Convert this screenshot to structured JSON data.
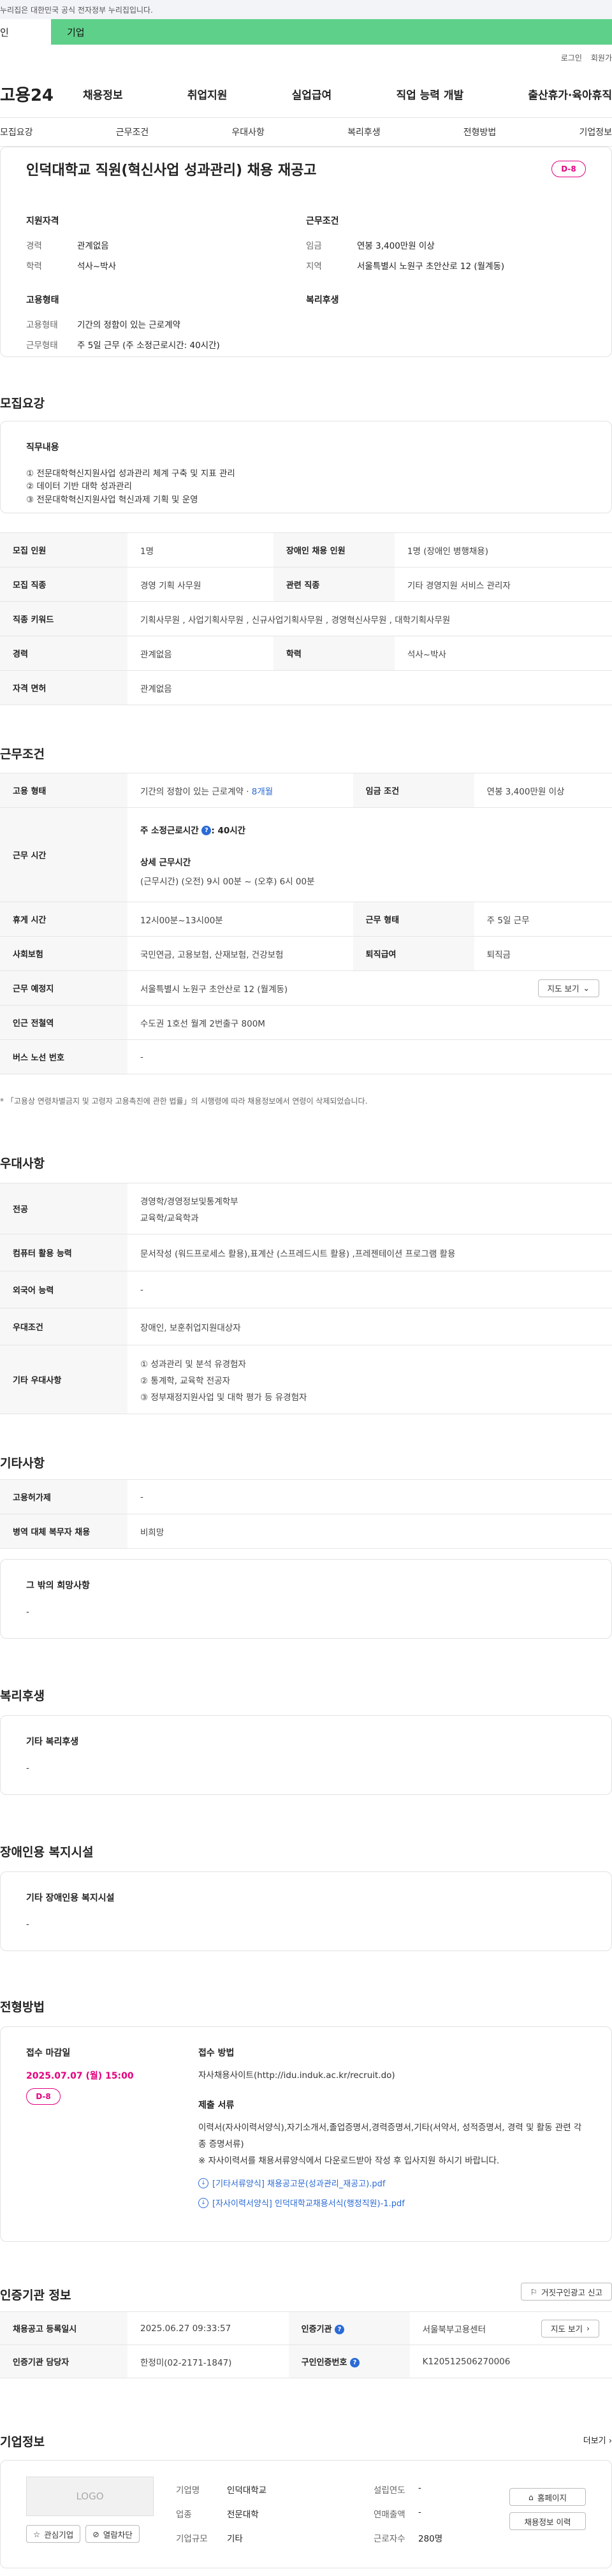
{
  "banner": {
    "text": "누리집은 대한민국 공식 전자정부 누리집입니다."
  },
  "tabs": {
    "t1": "인",
    "t2": "기업"
  },
  "util": {
    "login": "로그인",
    "signup": "회원가"
  },
  "gnb": {
    "logo": "고용24",
    "menu": [
      "채용정보",
      "취업지원",
      "실업급여",
      "직업 능력 개발",
      "출산휴가·육아휴직"
    ]
  },
  "anchors": [
    "모집요강",
    "근무조건",
    "우대사항",
    "복리후생",
    "전형방법",
    "기업정보"
  ],
  "title": {
    "heading": "인덕대학교 직원(혁신사업 성과관리) 채용 재공고",
    "dday": "D-8",
    "qual_title": "지원자격",
    "qual_rows": [
      {
        "k": "경력",
        "v": "관계없음"
      },
      {
        "k": "학력",
        "v": "석사~박사"
      }
    ],
    "cond_title": "근무조건",
    "cond_rows": [
      {
        "k": "임금",
        "v": "연봉 3,400만원 이상"
      },
      {
        "k": "지역",
        "v": "서울특별시 노원구 초안산로 12 (월계동)"
      }
    ],
    "emp_title": "고용형태",
    "emp_rows": [
      {
        "k": "고용형태",
        "v": "기간의 정함이 있는 근로계약"
      },
      {
        "k": "근무형태",
        "v": "주 5일 근무 (주 소정근로시간: 40시간)"
      }
    ],
    "welfare_title": "복리후생"
  },
  "recruit": {
    "section": "모집요강",
    "duty_title": "직무내용",
    "duty_lines": [
      "① 전문대학혁신지원사업 성과관리 체계 구축 및 지표 관리",
      "② 데이터 기반 대학 성과관리",
      "③ 전문대학혁신지원사업 혁신과제 기획 및 운영"
    ],
    "rows": [
      {
        "h1": "모집 인원",
        "v1": "1명",
        "h2": "장애인 채용 인원",
        "v2": "1명 (장애인 병행채용)"
      },
      {
        "h1": "모집 직종",
        "v1": "경영 기획 사무원",
        "h2": "관련 직종",
        "v2": "기타 경영지원 서비스 관리자"
      },
      {
        "h1": "직종 키워드",
        "v1": "기획사무원 , 사업기획사무원 , 신규사업기획사무원 , 경영혁신사무원 , 대학기획사무원"
      },
      {
        "h1": "경력",
        "v1": "관계없음",
        "h2": "학력",
        "v2": "석사~박사"
      },
      {
        "h1": "자격 면허",
        "v1": "관계없음"
      }
    ]
  },
  "work": {
    "section": "근무조건",
    "emp_h": "고용 형태",
    "emp_v": "기간의 정함이 있는 근로계약 · ",
    "emp_link": "8개월",
    "wage_h": "임금 조건",
    "wage_v": "연봉 3,400만원 이상",
    "hours_h": "근무 시간",
    "hours_sub": "주 소정근로시간",
    "hours_q": "?",
    "hours_sub_v": ": 40시간",
    "hours_detail_t": "상세 근무시간",
    "hours_detail_v": "(근무시간) (오전) 9시 00분 ~ (오후) 6시 00분",
    "rest_h": "휴게 시간",
    "rest_v": "12시00분~13시00분",
    "form_h": "근무 형태",
    "form_v": "주 5일 근무",
    "ins_h": "사회보험",
    "ins_v": "국민연금, 고용보험, 산재보험, 건강보험",
    "ret_h": "퇴직급여",
    "ret_v": "퇴직금",
    "loc_h": "근무 예정지",
    "loc_v": "서울특별시 노원구 초안산로 12 (월계동)",
    "map_btn": "지도 보기",
    "subway_h": "인근 전철역",
    "subway_v": "수도권 1호선 월계 2번출구 800M",
    "bus_h": "버스 노선 번호",
    "bus_v": "-",
    "note": "* 「고용상 연령차별금지 및 고령자 고용촉진에 관한 법률」의 시행령에 따라 채용정보에서 연령이 삭제되었습니다."
  },
  "pref": {
    "section": "우대사항",
    "rows": [
      {
        "h": "전공",
        "v": [
          "경영학/경영정보및통계학부",
          "교육학/교육학과"
        ]
      },
      {
        "h": "컴퓨터 활용 능력",
        "v": [
          "문서작성 (워드프로세스 활용),표계산 (스프레드시트 활용) ,프레젠테이션 프로그램 활용"
        ]
      },
      {
        "h": "외국어 능력",
        "v": [
          "-"
        ]
      },
      {
        "h": "우대조건",
        "v": [
          "장애인, 보훈취업지원대상자"
        ]
      },
      {
        "h": "기타 우대사항",
        "v": [
          "① 성과관리 및 분석 유경험자",
          "② 통계학, 교육학 전공자",
          "③ 정부재정지원사업 및 대학 평가 등 유경험자"
        ]
      }
    ]
  },
  "etc": {
    "section": "기타사항",
    "rows": [
      {
        "h": "고용허가제",
        "v": "-"
      },
      {
        "h": "병역 대체 복무자 채용",
        "v": "비희망"
      }
    ],
    "other_t": "그 밖의 희망사항",
    "other_v": "-"
  },
  "welfare": {
    "section": "복리후생",
    "t": "기타 복리후생",
    "v": "-"
  },
  "disability": {
    "section": "장애인용 복지시설",
    "t": "기타 장애인용 복지시설",
    "v": "-"
  },
  "process": {
    "section": "전형방법",
    "deadline_t": "접수 마감일",
    "deadline_v": "2025.07.07 (월) 15:00",
    "dday": "D-8",
    "method_t": "접수 방법",
    "method_v": "자사채용사이트(http://idu.induk.ac.kr/recruit.do)",
    "docs_t": "제출 서류",
    "docs_v": "이력서(자사이력서양식),자기소개서,졸업증명서,경력증명서,기타(서약서, 성적증명서, 경력 및 활동 관련 각종 증명서류)",
    "docs_note": "※ 자사이력서를 채용서류양식에서 다운로드받아 작성 후 입사지원 하시기 바랍니다.",
    "files": [
      "[기타서류양식] 채용공고문(성과관리_재공고).pdf",
      "[자사이력서양식] 인덕대학교채용서식(행정직원)-1.pdf"
    ]
  },
  "cert": {
    "section": "인증기관 정보",
    "report_btn": "거짓구인광고 신고",
    "rows": [
      {
        "h1": "채용공고 등록일시",
        "v1": "2025.06.27 09:33:57",
        "h2": "인증기관",
        "v2": "서울북부고용센터",
        "btn": "지도 보기"
      },
      {
        "h1": "인증기관 담당자",
        "v1": "한정미(02-2171-1847)",
        "h2": "구인인증번호",
        "v2": "K120512506270006"
      }
    ]
  },
  "company": {
    "section": "기업정보",
    "more": "더보기",
    "logo": "LOGO",
    "fav_btn": "관심기업",
    "block_btn": "열람차단",
    "rows": [
      {
        "k1": "기업명",
        "v1": "인덕대학교",
        "k2": "설립연도",
        "v2": "-"
      },
      {
        "k1": "업종",
        "v1": "전문대학",
        "k2": "연매출액",
        "v2": "-"
      },
      {
        "k1": "기업규모",
        "v1": "기타",
        "k2": "근로자수",
        "v2": "280명"
      }
    ],
    "home_btn": "홈페이지",
    "jobs_btn": "채용정보 이력"
  }
}
